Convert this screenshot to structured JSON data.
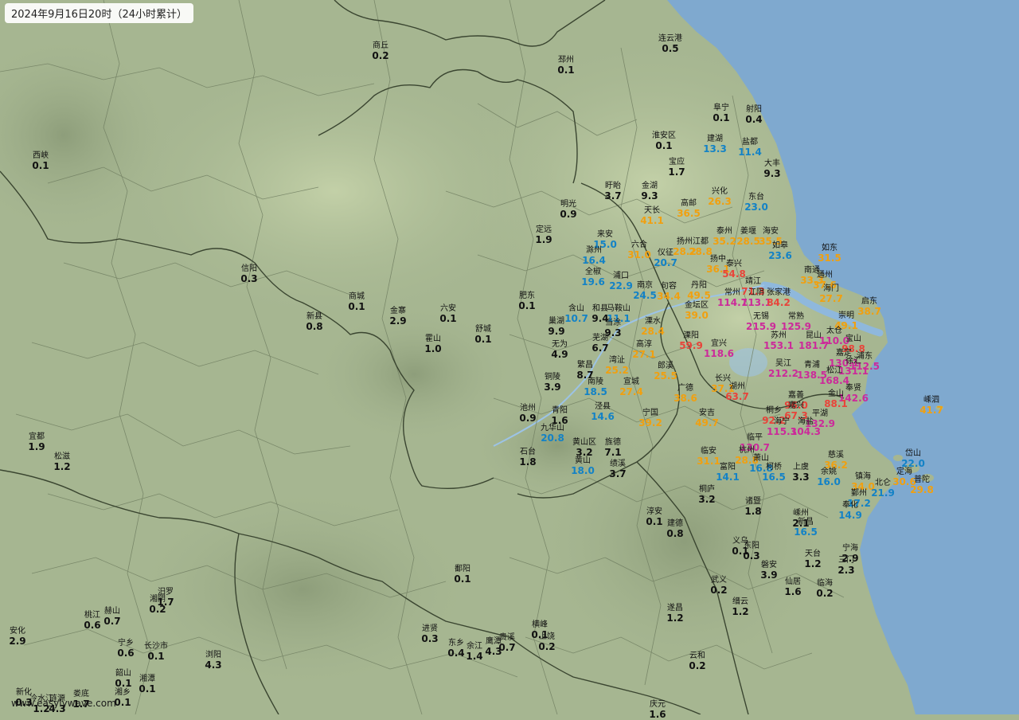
{
  "title": "2024年9月16日20时（24小时累计）",
  "watermark": "www.easylywave.com",
  "colors": {
    "land": "#a6b691",
    "land_light": "#c2cfa6",
    "sea": "#7fa9cf",
    "river": "#9cc3e6",
    "border": "#6f7d60",
    "province_border": "#3a4530",
    "blue": "#1382c6",
    "orange": "#f0a010",
    "red": "#e8443a",
    "magenta": "#cc2a9a",
    "green": "#7aa010"
  },
  "stations": [
    {
      "name": "连云港",
      "value": "0.5",
      "color": "black"
    },
    {
      "name": "商丘",
      "value": "0.2",
      "color": "black"
    },
    {
      "name": "邳州",
      "value": "0.1",
      "color": "black"
    },
    {
      "name": "阜宁",
      "value": "0.1",
      "color": "black"
    },
    {
      "name": "射阳",
      "value": "0.4",
      "color": "black"
    },
    {
      "name": "淮安区",
      "value": "0.1",
      "color": "black"
    },
    {
      "name": "建湖",
      "value": "13.3",
      "color": "blue"
    },
    {
      "name": "盐都",
      "value": "11.4",
      "color": "blue"
    },
    {
      "name": "西峡",
      "value": "0.1",
      "color": "black"
    },
    {
      "name": "宝应",
      "value": "1.7",
      "color": "black"
    },
    {
      "name": "大丰",
      "value": "9.3",
      "color": "black"
    },
    {
      "name": "盱眙",
      "value": "3.7",
      "color": "black"
    },
    {
      "name": "金湖",
      "value": "9.3",
      "color": "black"
    },
    {
      "name": "兴化",
      "value": "26.3",
      "color": "orange"
    },
    {
      "name": "东台",
      "value": "23.0",
      "color": "blue"
    },
    {
      "name": "明光",
      "value": "0.9",
      "color": "black"
    },
    {
      "name": "天长",
      "value": "41.1",
      "color": "orange"
    },
    {
      "name": "高邮",
      "value": "36.5",
      "color": "orange"
    },
    {
      "name": "定远",
      "value": "1.9",
      "color": "black"
    },
    {
      "name": "来安",
      "value": "15.0",
      "color": "blue"
    },
    {
      "name": "泰州",
      "value": "35.2",
      "color": "orange"
    },
    {
      "name": "姜堰",
      "value": "28.5",
      "color": "orange"
    },
    {
      "name": "海安",
      "value": "35.5",
      "color": "orange"
    },
    {
      "name": "六合",
      "value": "31.0",
      "color": "orange"
    },
    {
      "name": "扬州",
      "value": "28.2",
      "color": "orange"
    },
    {
      "name": "江都",
      "value": "28.8",
      "color": "orange"
    },
    {
      "name": "如皋",
      "value": "23.6",
      "color": "blue"
    },
    {
      "name": "滁州",
      "value": "16.4",
      "color": "blue"
    },
    {
      "name": "仪征",
      "value": "20.7",
      "color": "blue"
    },
    {
      "name": "如东",
      "value": "31.5",
      "color": "orange"
    },
    {
      "name": "信阳",
      "value": "0.3",
      "color": "black"
    },
    {
      "name": "全椒",
      "value": "19.6",
      "color": "blue"
    },
    {
      "name": "扬中",
      "value": "36.1",
      "color": "orange"
    },
    {
      "name": "泰兴",
      "value": "54.8",
      "color": "red"
    },
    {
      "name": "浦口",
      "value": "22.9",
      "color": "blue"
    },
    {
      "name": "南通",
      "value": "33.3",
      "color": "orange"
    },
    {
      "name": "通州",
      "value": "37.6",
      "color": "orange"
    },
    {
      "name": "商城",
      "value": "0.1",
      "color": "black"
    },
    {
      "name": "肥东",
      "value": "0.1",
      "color": "black"
    },
    {
      "name": "南京",
      "value": "24.5",
      "color": "blue"
    },
    {
      "name": "句容",
      "value": "34.4",
      "color": "orange"
    },
    {
      "name": "丹阳",
      "value": "49.5",
      "color": "orange"
    },
    {
      "name": "靖江",
      "value": "71.3",
      "color": "red"
    },
    {
      "name": "常州",
      "value": "114.7",
      "color": "magenta"
    },
    {
      "name": "江阴",
      "value": "113.1",
      "color": "magenta"
    },
    {
      "name": "张家港",
      "value": "84.2",
      "color": "red"
    },
    {
      "name": "海门",
      "value": "27.7",
      "color": "orange"
    },
    {
      "name": "启东",
      "value": "38.7",
      "color": "orange"
    },
    {
      "name": "六安",
      "value": "0.1",
      "color": "black"
    },
    {
      "name": "含山",
      "value": "10.7",
      "color": "blue"
    },
    {
      "name": "和县",
      "value": "9.4",
      "color": "black"
    },
    {
      "name": "马鞍山",
      "value": "11.1",
      "color": "blue"
    },
    {
      "name": "金坛区",
      "value": "39.0",
      "color": "orange"
    },
    {
      "name": "新县",
      "value": "0.8",
      "color": "black"
    },
    {
      "name": "金寨",
      "value": "2.9",
      "color": "black"
    },
    {
      "name": "当涂",
      "value": "9.3",
      "color": "black"
    },
    {
      "name": "溧水",
      "value": "28.4",
      "color": "orange"
    },
    {
      "name": "无锡",
      "value": "215.9",
      "color": "magenta"
    },
    {
      "name": "常熟",
      "value": "125.9",
      "color": "magenta"
    },
    {
      "name": "崇明",
      "value": "49.1",
      "color": "orange"
    },
    {
      "name": "巢湖",
      "value": "9.9",
      "color": "black"
    },
    {
      "name": "舒城",
      "value": "0.1",
      "color": "black"
    },
    {
      "name": "芜湖",
      "value": "6.7",
      "color": "black"
    },
    {
      "name": "溧阳",
      "value": "59.9",
      "color": "red"
    },
    {
      "name": "宜兴",
      "value": "118.6",
      "color": "magenta"
    },
    {
      "name": "苏州",
      "value": "153.1",
      "color": "magenta"
    },
    {
      "name": "昆山",
      "value": "181.7",
      "color": "magenta"
    },
    {
      "name": "太仓",
      "value": "110.0",
      "color": "magenta"
    },
    {
      "name": "宝山",
      "value": "98.8",
      "color": "red"
    },
    {
      "name": "霍山",
      "value": "1.0",
      "color": "black"
    },
    {
      "name": "无为",
      "value": "4.9",
      "color": "black"
    },
    {
      "name": "高淳",
      "value": "27.1",
      "color": "orange"
    },
    {
      "name": "嘉定",
      "value": "130.1",
      "color": "magenta"
    },
    {
      "name": "浦东",
      "value": "112.5",
      "color": "magenta"
    },
    {
      "name": "徐汇",
      "value": "131.1",
      "color": "magenta"
    },
    {
      "name": "繁昌",
      "value": "8.7",
      "color": "black"
    },
    {
      "name": "湾沚",
      "value": "25.2",
      "color": "orange"
    },
    {
      "name": "吴江",
      "value": "212.2",
      "color": "magenta"
    },
    {
      "name": "青浦",
      "value": "138.5",
      "color": "magenta"
    },
    {
      "name": "郎溪",
      "value": "25.5",
      "color": "orange"
    },
    {
      "name": "松江",
      "value": "168.4",
      "color": "magenta"
    },
    {
      "name": "铜陵",
      "value": "3.9",
      "color": "black"
    },
    {
      "name": "南陵",
      "value": "18.5",
      "color": "blue"
    },
    {
      "name": "宣城",
      "value": "27.4",
      "color": "orange"
    },
    {
      "name": "长兴",
      "value": "37.1",
      "color": "orange"
    },
    {
      "name": "奉贤",
      "value": "142.6",
      "color": "magenta"
    },
    {
      "name": "湖州",
      "value": "63.7",
      "color": "red"
    },
    {
      "name": "广德",
      "value": "38.6",
      "color": "orange"
    },
    {
      "name": "嘉善",
      "value": "96.0",
      "color": "red"
    },
    {
      "name": "金山",
      "value": "88.1",
      "color": "red"
    },
    {
      "name": "嵊泗",
      "value": "41.7",
      "color": "orange"
    },
    {
      "name": "池州",
      "value": "0.9",
      "color": "black"
    },
    {
      "name": "青阳",
      "value": "1.6",
      "color": "black"
    },
    {
      "name": "泾县",
      "value": "14.6",
      "color": "blue"
    },
    {
      "name": "宁国",
      "value": "39.2",
      "color": "orange"
    },
    {
      "name": "安吉",
      "value": "49.7",
      "color": "orange"
    },
    {
      "name": "桐乡",
      "value": "92.2",
      "color": "red"
    },
    {
      "name": "嘉兴",
      "value": "67.3",
      "color": "red"
    },
    {
      "name": "平湖",
      "value": "132.9",
      "color": "magenta"
    },
    {
      "name": "九华山",
      "value": "20.8",
      "color": "blue"
    },
    {
      "name": "海宁",
      "value": "115.3",
      "color": "magenta"
    },
    {
      "name": "海盐",
      "value": "104.3",
      "color": "magenta"
    },
    {
      "name": "宜都",
      "value": "1.9",
      "color": "black"
    },
    {
      "name": "临平",
      "value": "130.7",
      "color": "magenta"
    },
    {
      "name": "黄山区",
      "value": "3.2",
      "color": "black"
    },
    {
      "name": "旌德",
      "value": "7.1",
      "color": "black"
    },
    {
      "name": "石台",
      "value": "1.8",
      "color": "black"
    },
    {
      "name": "松滋",
      "value": "1.2",
      "color": "black"
    },
    {
      "name": "临安",
      "value": "31.1",
      "color": "orange"
    },
    {
      "name": "杭州",
      "value": "28.8",
      "color": "orange"
    },
    {
      "name": "萧山",
      "value": "16.8",
      "color": "blue"
    },
    {
      "name": "慈溪",
      "value": "36.2",
      "color": "orange"
    },
    {
      "name": "岱山",
      "value": "22.0",
      "color": "blue"
    },
    {
      "name": "定海",
      "value": "30.6",
      "color": "orange"
    },
    {
      "name": "黄山",
      "value": "18.0",
      "color": "blue"
    },
    {
      "name": "绩溪",
      "value": "3.7",
      "color": "black"
    },
    {
      "name": "富阳",
      "value": "14.1",
      "color": "blue"
    },
    {
      "name": "柯桥",
      "value": "16.5",
      "color": "blue"
    },
    {
      "name": "上虞",
      "value": "3.3",
      "color": "black"
    },
    {
      "name": "余姚",
      "value": "16.0",
      "color": "blue"
    },
    {
      "name": "镇海",
      "value": "34.0",
      "color": "orange"
    },
    {
      "name": "北仑",
      "value": "21.9",
      "color": "blue"
    },
    {
      "name": "普陀",
      "value": "29.8",
      "color": "orange"
    },
    {
      "name": "桐庐",
      "value": "3.2",
      "color": "black"
    },
    {
      "name": "诸暨",
      "value": "1.8",
      "color": "black"
    },
    {
      "name": "鄞州",
      "value": "17.2",
      "color": "blue"
    },
    {
      "name": "奉化",
      "value": "14.9",
      "color": "blue"
    },
    {
      "name": "淳安",
      "value": "0.1",
      "color": "black"
    },
    {
      "name": "建德",
      "value": "0.8",
      "color": "black"
    },
    {
      "name": "嵊州",
      "value": "2.1",
      "color": "black"
    },
    {
      "name": "新昌",
      "value": "16.5",
      "color": "blue"
    },
    {
      "name": "义乌",
      "value": "0.1",
      "color": "black"
    },
    {
      "name": "东阳",
      "value": "0.3",
      "color": "black"
    },
    {
      "name": "宁海",
      "value": "2.9",
      "color": "black"
    },
    {
      "name": "天台",
      "value": "1.2",
      "color": "black"
    },
    {
      "name": "三门",
      "value": "2.3",
      "color": "black"
    },
    {
      "name": "鄱阳",
      "value": "0.1",
      "color": "black"
    },
    {
      "name": "磐安",
      "value": "3.9",
      "color": "black"
    },
    {
      "name": "武义",
      "value": "0.2",
      "color": "black"
    },
    {
      "name": "仙居",
      "value": "1.6",
      "color": "black"
    },
    {
      "name": "临海",
      "value": "0.2",
      "color": "black"
    },
    {
      "name": "汨罗",
      "value": "1.7",
      "color": "black"
    },
    {
      "name": "湘阴",
      "value": "0.2",
      "color": "black"
    },
    {
      "name": "缙云",
      "value": "1.2",
      "color": "black"
    },
    {
      "name": "桃江",
      "value": "0.6",
      "color": "black"
    },
    {
      "name": "赫山",
      "value": "0.7",
      "color": "black"
    },
    {
      "name": "横峰",
      "value": "0.1",
      "color": "black"
    },
    {
      "name": "上饶",
      "value": "0.2",
      "color": "black"
    },
    {
      "name": "遂昌",
      "value": "1.2",
      "color": "black"
    },
    {
      "name": "进贤",
      "value": "0.3",
      "color": "black"
    },
    {
      "name": "安化",
      "value": "2.9",
      "color": "black"
    },
    {
      "name": "宁乡",
      "value": "0.6",
      "color": "black"
    },
    {
      "name": "东乡",
      "value": "0.4",
      "color": "black"
    },
    {
      "name": "余江",
      "value": "1.4",
      "color": "black"
    },
    {
      "name": "鹰潭",
      "value": "4.3",
      "color": "black"
    },
    {
      "name": "贵溪",
      "value": "0.7",
      "color": "black"
    },
    {
      "name": "长沙市",
      "value": "0.1",
      "color": "black"
    },
    {
      "name": "浏阳",
      "value": "4.3",
      "color": "black"
    },
    {
      "name": "云和",
      "value": "0.2",
      "color": "black"
    },
    {
      "name": "韶山",
      "value": "0.1",
      "color": "black"
    },
    {
      "name": "湘潭",
      "value": "0.1",
      "color": "black"
    },
    {
      "name": "新化",
      "value": "0.3",
      "color": "black"
    },
    {
      "name": "冷水江",
      "value": "1.2",
      "color": "black"
    },
    {
      "name": "涟源",
      "value": "4.3",
      "color": "black"
    },
    {
      "name": "娄底",
      "value": "1.7",
      "color": "black"
    },
    {
      "name": "湘乡",
      "value": "0.1",
      "color": "black"
    },
    {
      "name": "庆元",
      "value": "1.6",
      "color": "black"
    }
  ]
}
